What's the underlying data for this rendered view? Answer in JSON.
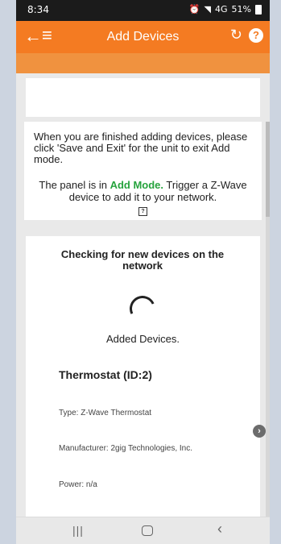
{
  "status_bar": {
    "time": "8:34",
    "signal": "4G",
    "battery": "51%"
  },
  "app_bar": {
    "title": "Add Devices"
  },
  "instructions": {
    "text": "When you are finished adding devices, please click 'Save and Exit' for the unit to exit Add mode.",
    "panel_prefix": "The panel is in",
    "mode_label": "Add Mode.",
    "panel_suffix": "Trigger a Z-Wave device to add it to your network.",
    "help_badge": "?"
  },
  "devices": {
    "checking": "Checking for new devices on the network",
    "added_label": "Added Devices.",
    "device": {
      "name": "Thermostat (ID:2)",
      "type": "Type: Z-Wave Thermostat",
      "manufacturer": "Manufacturer: 2gig Technologies, Inc.",
      "power": "Power: n/a"
    }
  },
  "colors": {
    "accent": "#f47b22",
    "mode_green": "#26a33d"
  }
}
